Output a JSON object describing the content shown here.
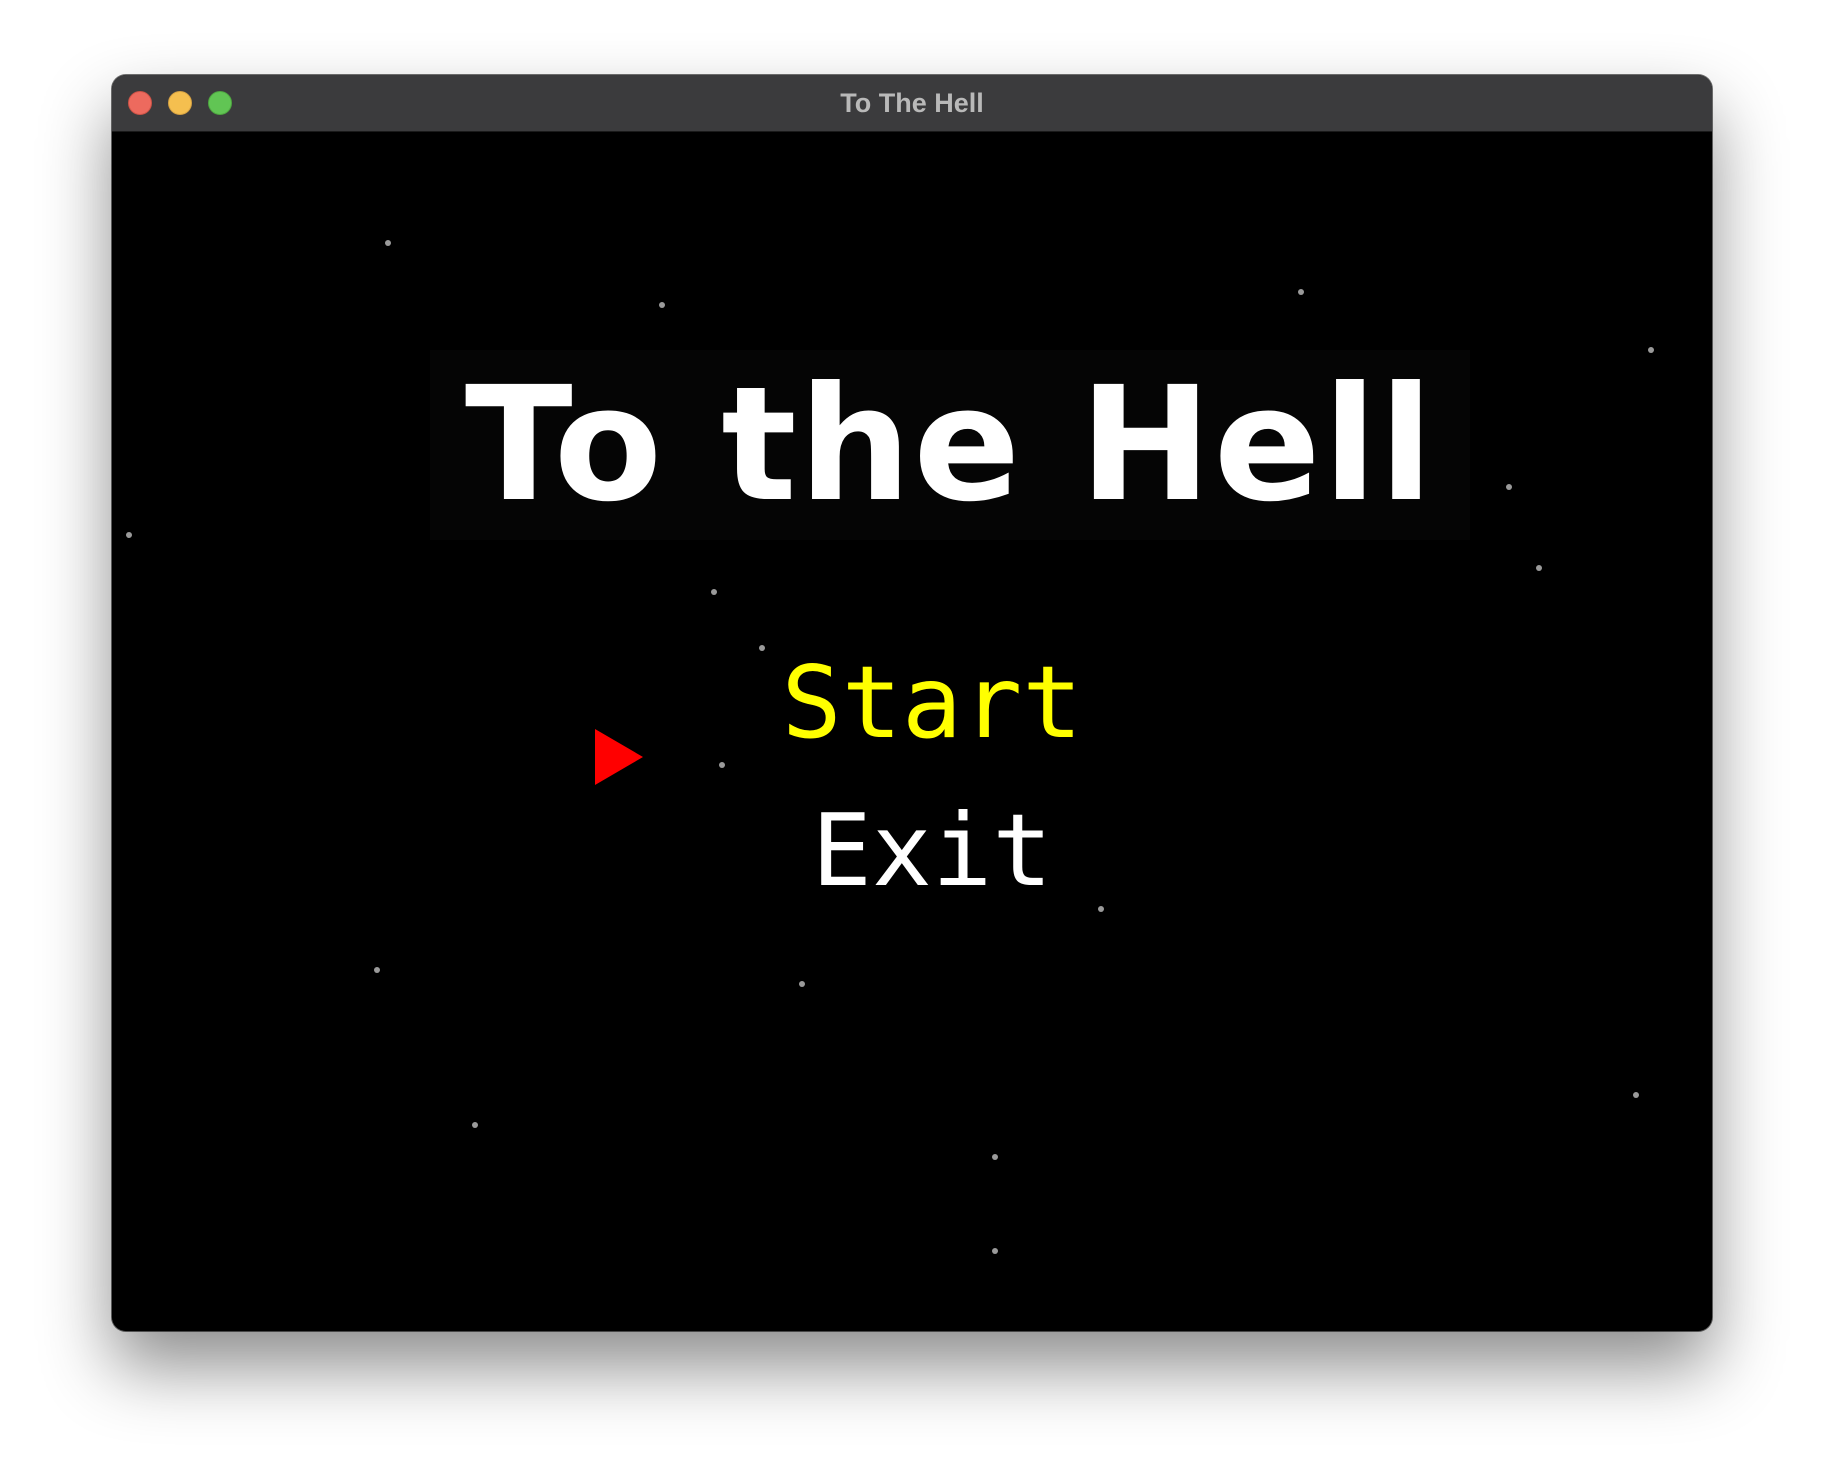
{
  "window": {
    "title": "To The Hell"
  },
  "game": {
    "logo_text": "To the Hell",
    "menu": {
      "items": [
        {
          "label": "Start",
          "selected": true,
          "color": "#ffff00"
        },
        {
          "label": "Exit",
          "selected": false,
          "color": "#ffffff"
        }
      ],
      "cursor_icon": "red-triangle-pointer",
      "cursor_color": "#ff0000"
    },
    "background_color": "#000000"
  }
}
